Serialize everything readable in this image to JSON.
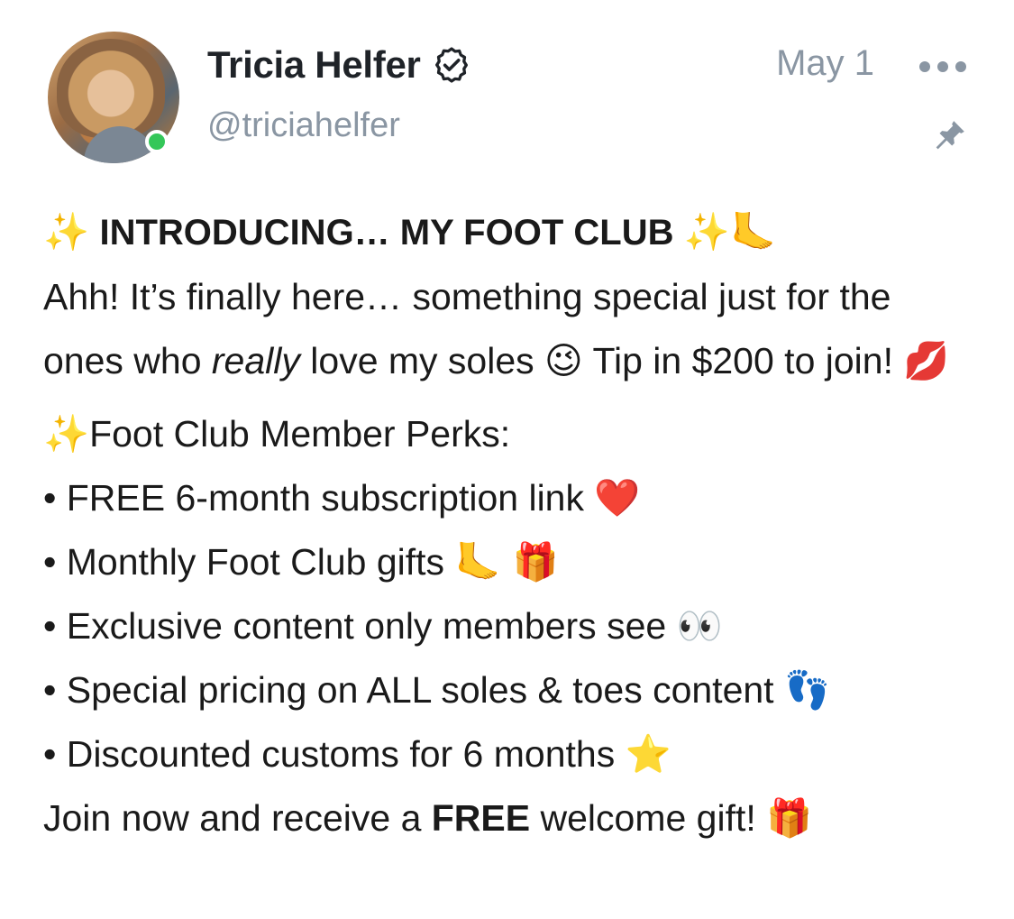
{
  "post": {
    "author": {
      "name": "Tricia Helfer",
      "handle": "@triciahelfer",
      "verified": true,
      "online": true
    },
    "date": "May 1",
    "icons": {
      "verified": "verified-badge-icon",
      "more": "more-options-icon",
      "pin": "pin-icon"
    },
    "colors": {
      "online_dot": "#34c759",
      "muted_text": "#8a96a3",
      "name_text": "#1f2328"
    },
    "headline": {
      "sparkles_left": "✨",
      "text": "INTRODUCING… MY FOOT CLUB",
      "sparkles_right": "✨",
      "foot": "🦶"
    },
    "intro": {
      "part1": "Ahh! It’s finally here… something special just for the ones who ",
      "emphasis": "really",
      "part2": " love my soles ",
      "wink": "😉",
      "part3": " Tip in $200 to join! ",
      "kiss": "💋"
    },
    "perks_heading": {
      "sparkles": "✨",
      "text": "Foot Club Member Perks:"
    },
    "perks": [
      {
        "bullet": "•",
        "text": "FREE 6-month subscription link ",
        "emoji": "❤️"
      },
      {
        "bullet": "•",
        "text": "Monthly Foot Club gifts ",
        "emoji": "🦶 🎁"
      },
      {
        "bullet": "•",
        "text": "Exclusive content only members see ",
        "emoji": "👀"
      },
      {
        "bullet": "•",
        "text": "Special pricing on ALL soles & toes content ",
        "emoji": "👣"
      },
      {
        "bullet": "•",
        "text": "Discounted customs for 6 months ",
        "emoji": "⭐"
      }
    ],
    "closing": {
      "part1": "Join now and receive a ",
      "bold": "FREE",
      "part2": " welcome gift! ",
      "emoji": "🎁"
    }
  }
}
